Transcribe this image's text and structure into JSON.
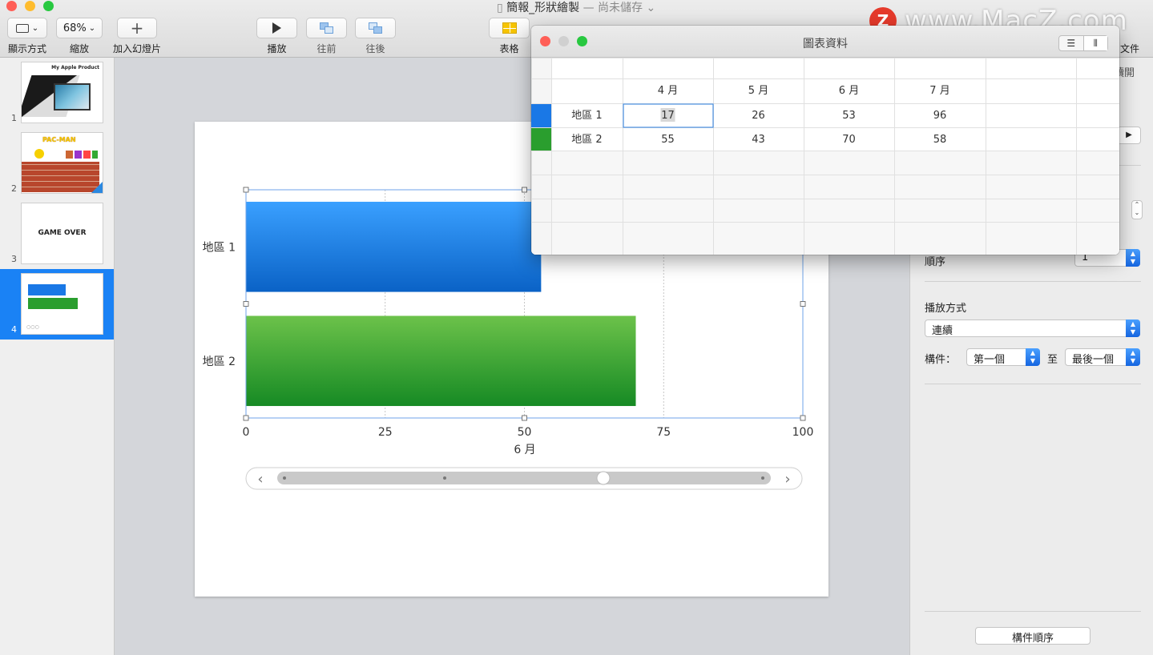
{
  "toolbar": {
    "view_label": "顯示方式",
    "zoom_value": "68%",
    "zoom_label": "縮放",
    "add_slide_label": "加入幻燈片",
    "play_label": "播放",
    "back_label": "往前",
    "forward_label": "往後",
    "table_label": "表格",
    "document_label": "文件"
  },
  "document": {
    "title": "簡報_形狀繪製",
    "status": "— 尚未儲存"
  },
  "watermark": {
    "logo_letter": "Z",
    "text": "www.MacZ.com"
  },
  "sidebar": {
    "slides": [
      {
        "number": "1",
        "caption": "My Apple Product"
      },
      {
        "number": "2",
        "caption": "PAC-MAN"
      },
      {
        "number": "3",
        "caption": "GAME OVER"
      },
      {
        "number": "4",
        "caption": ""
      }
    ]
  },
  "chart_data": {
    "type": "bar",
    "orientation": "horizontal",
    "categories": [
      "地區 1",
      "地區 2"
    ],
    "series": [
      {
        "values": [
          53,
          70
        ]
      }
    ],
    "xlabel": "6 月",
    "xlim": [
      0,
      100
    ],
    "xticks": [
      "0",
      "25",
      "50",
      "75",
      "100"
    ],
    "grid": true,
    "colors": [
      "#1a78e6",
      "#2a9e2e"
    ]
  },
  "chart_data_window": {
    "title": "圖表資料",
    "columns": [
      "4 月",
      "5 月",
      "6 月",
      "7 月"
    ],
    "rows": [
      {
        "label": "地區 1",
        "color": "#1a78e6",
        "values": [
          "17",
          "26",
          "53",
          "96"
        ]
      },
      {
        "label": "地區 2",
        "color": "#2a9e2e",
        "values": [
          "55",
          "43",
          "70",
          "58"
        ]
      }
    ]
  },
  "inspector": {
    "tab_partial": "讀開",
    "order_label": "順序",
    "order_value": "1",
    "delivery_label": "播放方式",
    "delivery_value": "連續",
    "build_label": "構件：",
    "build_from": "第一個",
    "build_to_label": "至",
    "build_to": "最後一個",
    "build_order_button": "構件順序"
  }
}
